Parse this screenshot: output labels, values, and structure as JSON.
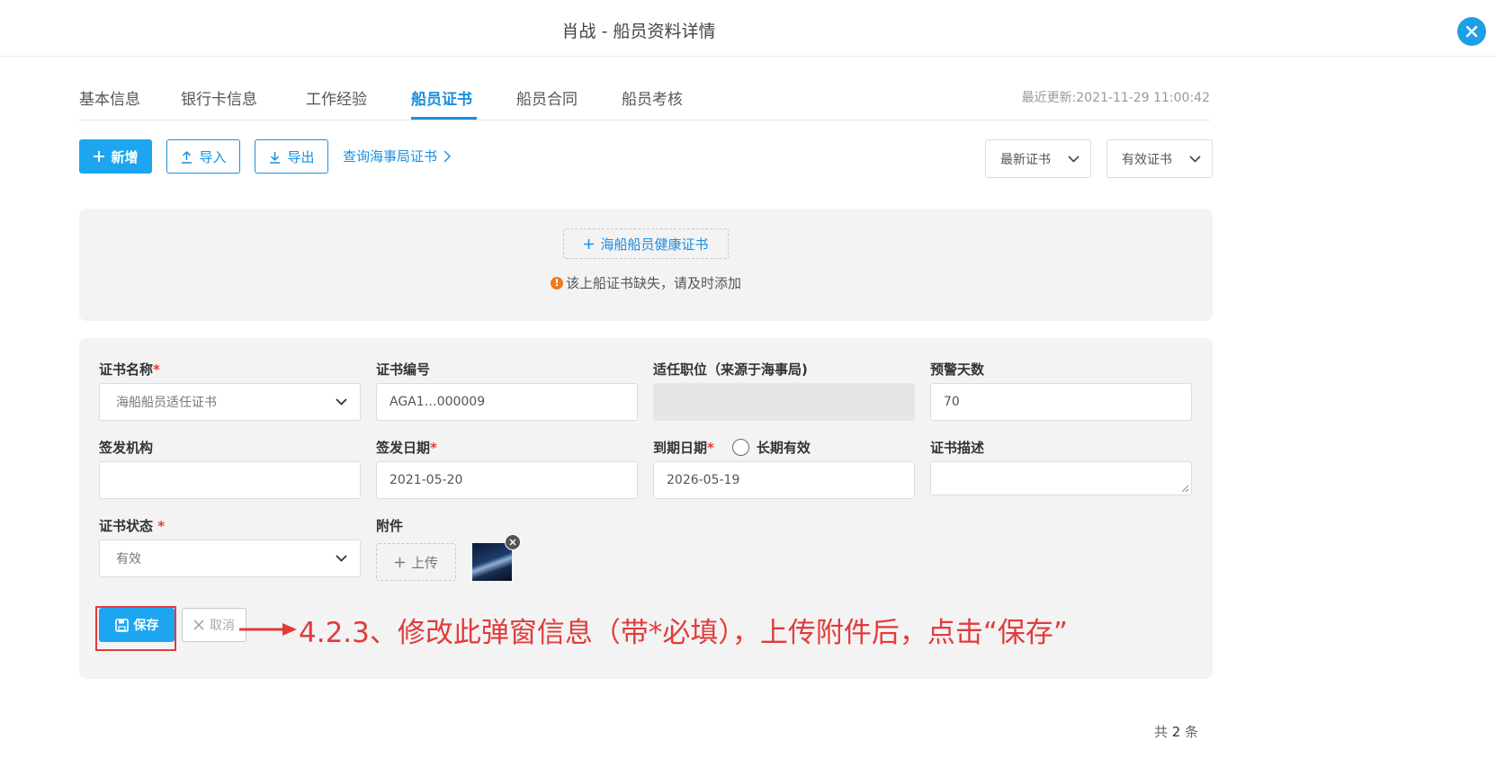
{
  "header": {
    "title": "肖战 - 船员资料详情",
    "close_icon": "close-icon"
  },
  "tabs": [
    {
      "label": "基本信息"
    },
    {
      "label": "银行卡信息"
    },
    {
      "label": "工作经验"
    },
    {
      "label": "船员证书",
      "active": true
    },
    {
      "label": "船员合同"
    },
    {
      "label": "船员考核"
    }
  ],
  "last_update": "最近更新:2021-11-29 11:00:42",
  "toolbar": {
    "add_label": "新增",
    "import_label": "导入",
    "export_label": "导出",
    "query_link": "查询海事局证书"
  },
  "filters": {
    "sort_value": "最新证书",
    "validity_value": "有效证书"
  },
  "missing_cert": {
    "add_label": "海船船员健康证书",
    "warning": "该上船证书缺失，请及时添加"
  },
  "form": {
    "cert_name": {
      "label": "证书名称",
      "value": "海船船员适任证书"
    },
    "cert_no": {
      "label": "证书编号",
      "value": "AGA1…000009"
    },
    "position": {
      "label": "适任职位（来源于海事局)",
      "value": ""
    },
    "warn_days": {
      "label": "预警天数",
      "value": "70"
    },
    "issuer": {
      "label": "签发机构",
      "value": ""
    },
    "issue_date": {
      "label": "签发日期",
      "value": "2021-05-20"
    },
    "expire_date": {
      "label": "到期日期",
      "value": "2026-05-19"
    },
    "long_term": {
      "label": "长期有效",
      "checked": false
    },
    "description": {
      "label": "证书描述",
      "value": ""
    },
    "status": {
      "label": "证书状态",
      "value": "有效"
    },
    "attachment": {
      "label": "附件",
      "upload_label": "上传"
    },
    "required_mark": "*",
    "save_label": "保存",
    "cancel_label": "取消"
  },
  "annotation": "4.2.3、修改此弹窗信息（带*必填），上传附件后，点击“保存”",
  "pagination": {
    "prefix": "共",
    "count": "2",
    "suffix": "条"
  },
  "colors": {
    "primary": "#1da6ef",
    "link": "#1a8fe0",
    "required": "#e23b3b",
    "annotation": "#e23b3b",
    "warning": "#f07a1a"
  }
}
